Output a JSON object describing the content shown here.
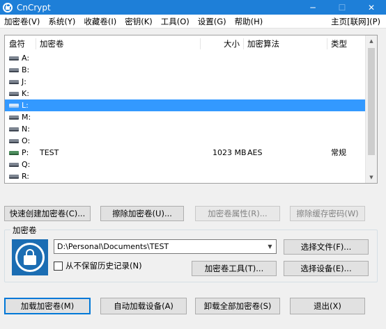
{
  "window": {
    "title": "CnCrypt",
    "minimize": "─",
    "maximize": "☐",
    "close": "✕"
  },
  "menu": {
    "items": [
      "加密卷(V)",
      "系统(Y)",
      "收藏卷(I)",
      "密钥(K)",
      "工具(O)",
      "设置(G)",
      "帮助(H)"
    ],
    "homepage": "主页[联网](P)"
  },
  "table": {
    "headers": {
      "drive": "盘符",
      "volume": "加密卷",
      "size": "大小",
      "algorithm": "加密算法",
      "type": "类型"
    },
    "rows": [
      {
        "drive": "A:",
        "volume": "",
        "size": "",
        "algorithm": "",
        "type": ""
      },
      {
        "drive": "B:",
        "volume": "",
        "size": "",
        "algorithm": "",
        "type": ""
      },
      {
        "drive": "J:",
        "volume": "",
        "size": "",
        "algorithm": "",
        "type": ""
      },
      {
        "drive": "K:",
        "volume": "",
        "size": "",
        "algorithm": "",
        "type": ""
      },
      {
        "drive": "L:",
        "volume": "",
        "size": "",
        "algorithm": "",
        "type": "",
        "selected": true
      },
      {
        "drive": "M:",
        "volume": "",
        "size": "",
        "algorithm": "",
        "type": ""
      },
      {
        "drive": "N:",
        "volume": "",
        "size": "",
        "algorithm": "",
        "type": ""
      },
      {
        "drive": "O:",
        "volume": "",
        "size": "",
        "algorithm": "",
        "type": ""
      },
      {
        "drive": "P:",
        "volume": "TEST",
        "size": "1023 MB",
        "algorithm": "AES",
        "type": "常规",
        "mounted": true
      },
      {
        "drive": "Q:",
        "volume": "",
        "size": "",
        "algorithm": "",
        "type": ""
      },
      {
        "drive": "R:",
        "volume": "",
        "size": "",
        "algorithm": "",
        "type": ""
      }
    ]
  },
  "actions": {
    "create_volume": "快速创建加密卷(C)...",
    "erase_volume": "擦除加密卷(U)...",
    "volume_properties": "加密卷属性(R)...",
    "wipe_cache": "擦除缓存密码(W)"
  },
  "volume_group": {
    "legend": "加密卷",
    "path": "D:\\Personal\\Documents\\TEST",
    "no_history_label": "从不保留历史记录(N)",
    "select_file": "选择文件(F)...",
    "volume_tools": "加密卷工具(T)...",
    "select_device": "选择设备(E)..."
  },
  "bottom": {
    "mount": "加载加密卷(M)",
    "auto_mount": "自动加载设备(A)",
    "dismount_all": "卸载全部加密卷(S)",
    "exit": "退出(X)"
  },
  "colors": {
    "titlebar": "#1e7fd8",
    "selection": "#3399ff",
    "logo": "#1b6db3"
  }
}
